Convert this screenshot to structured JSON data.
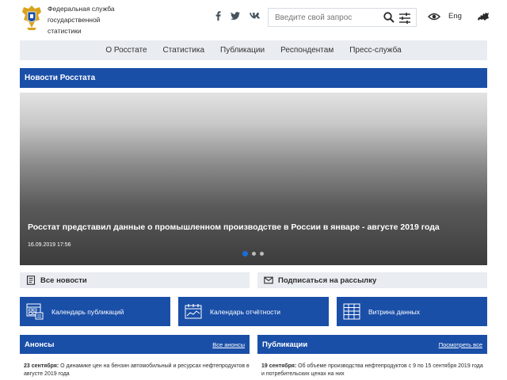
{
  "header": {
    "org_name_line1": "Федеральная служба",
    "org_name_line2": "государственной",
    "org_name_line3": "статистики",
    "social": [
      "f",
      "🐦",
      "vk"
    ],
    "search_placeholder": "Введите свой запрос",
    "lang": "Eng",
    "icons": [
      "emblem-icon",
      "facebook-icon",
      "twitter-icon",
      "vk-icon",
      "search-icon",
      "filter-icon",
      "eye-icon",
      "russia-map-icon"
    ]
  },
  "nav": {
    "items": [
      "О Росстате",
      "Статистика",
      "Публикации",
      "Респондентам",
      "Пресс-служба"
    ]
  },
  "news": {
    "bar_title": "Новости Росстата",
    "slide_title": "Росстат представил данные о промышленном производстве в России в январе - августе 2019 года",
    "slide_date": "16.09.2019 17:56",
    "active_slide": 1,
    "slide_count": 3
  },
  "links": {
    "all_news": "Все новости",
    "subscribe": "Подписаться на рассылку"
  },
  "tiles": [
    "Календарь публикаций",
    "Календарь отчётности",
    "Витрина данных"
  ],
  "announcements": {
    "title": "Анонсы",
    "more": "Все анонсы",
    "item_date": "23 сентября:",
    "item_text": "О динамике цен на бензин автомобильный и ресурсах нефтепродуктов в августе 2019 года"
  },
  "publications": {
    "title": "Публикации",
    "more": "Посмотреть все",
    "item_date": "19 сентября:",
    "item_text": "Об объеме производства нефтепродуктов с 9 по 15 сентября 2019 года и потребительских ценах на них"
  },
  "colors": {
    "brand_blue": "#1a4fa8",
    "nav_bg": "#e9ecf1",
    "slider_active": "#1a6ed8"
  }
}
